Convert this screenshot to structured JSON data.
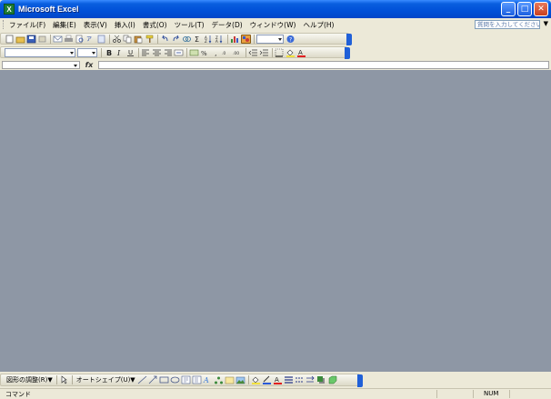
{
  "window": {
    "title": "Microsoft Excel",
    "app_icon_letter": "X",
    "minimize_label": "_",
    "maximize_label": "□",
    "close_label": "✕"
  },
  "menu": {
    "items": [
      "ファイル(F)",
      "編集(E)",
      "表示(V)",
      "挿入(I)",
      "書式(O)",
      "ツール(T)",
      "データ(D)",
      "ウィンドウ(W)",
      "ヘルプ(H)"
    ],
    "help_placeholder": "質問を入力してください",
    "help_arrow": "▼"
  },
  "toolbars": {
    "standard": {
      "icons": [
        "new-icon",
        "open-icon",
        "save-icon",
        "permission-icon",
        "email-icon",
        "print-icon",
        "print-preview-icon",
        "spelling-icon",
        "research-icon",
        "cut-icon",
        "copy-icon",
        "paste-icon",
        "format-painter-icon",
        "undo-icon",
        "redo-icon",
        "hyperlink-icon",
        "autosum-icon",
        "sort-ascending-icon",
        "sort-descending-icon",
        "chart-wizard-icon",
        "drawing-icon"
      ],
      "zoom_value": "",
      "help_icon": "help-icon"
    },
    "formatting": {
      "font_name": "",
      "font_size": "",
      "icons": [
        "bold-icon",
        "italic-icon",
        "underline-icon",
        "align-left-icon",
        "center-icon",
        "align-right-icon",
        "merge-center-icon",
        "currency-icon",
        "percent-icon",
        "comma-icon",
        "increase-decimal-icon",
        "decrease-decimal-icon",
        "decrease-indent-icon",
        "increase-indent-icon",
        "borders-icon",
        "fill-color-icon",
        "font-color-icon"
      ]
    }
  },
  "formula_bar": {
    "name_box": "",
    "fx_label": "fx",
    "formula": ""
  },
  "drawing_toolbar": {
    "draw_menu": "図形の調整(R)▼",
    "autoshapes_menu": "オートシェイプ(U)▼",
    "icons": [
      "select-objects-icon",
      "line-icon",
      "arrow-icon",
      "rectangle-icon",
      "oval-icon",
      "textbox-icon",
      "vertical-textbox-icon",
      "wordart-icon",
      "diagram-icon",
      "clipart-icon",
      "picture-icon",
      "fill-color-icon",
      "line-color-icon",
      "font-color-icon",
      "line-style-icon",
      "dash-style-icon",
      "arrow-style-icon",
      "shadow-icon",
      "3d-icon"
    ]
  },
  "status_bar": {
    "status": "コマンド",
    "num_indicator": "NUM"
  },
  "colors": {
    "workspace": "#8E97A5",
    "titlebar": "#0050D8",
    "chrome": "#ECE9D8"
  }
}
